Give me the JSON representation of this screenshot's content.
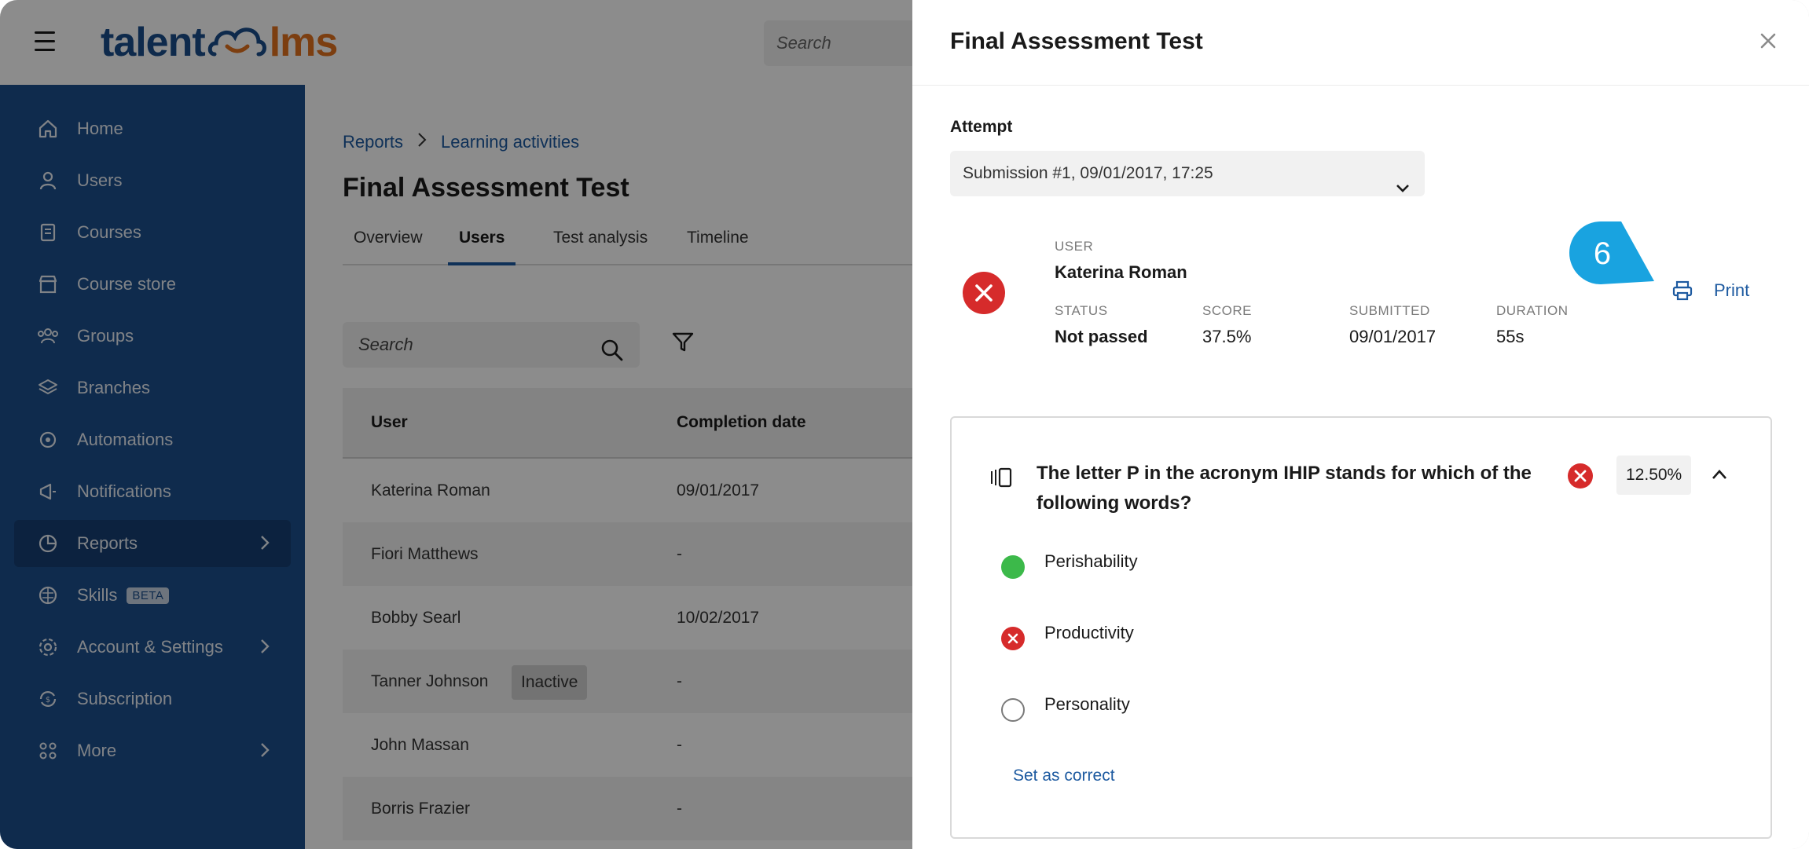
{
  "app": {
    "logo_part1": "talent",
    "logo_part2": "lms",
    "top_search_placeholder": "Search"
  },
  "sidebar": {
    "items": [
      {
        "label": "Home",
        "icon": "home-icon"
      },
      {
        "label": "Users",
        "icon": "user-icon"
      },
      {
        "label": "Courses",
        "icon": "book-icon"
      },
      {
        "label": "Course store",
        "icon": "store-icon"
      },
      {
        "label": "Groups",
        "icon": "groups-icon"
      },
      {
        "label": "Branches",
        "icon": "layers-icon"
      },
      {
        "label": "Automations",
        "icon": "automation-icon"
      },
      {
        "label": "Notifications",
        "icon": "megaphone-icon"
      },
      {
        "label": "Reports",
        "icon": "pie-chart-icon",
        "active": true,
        "has_submenu": true
      },
      {
        "label": "Skills",
        "icon": "brain-icon",
        "badge": "BETA"
      },
      {
        "label": "Account & Settings",
        "icon": "gear-icon",
        "has_submenu": true
      },
      {
        "label": "Subscription",
        "icon": "subscription-icon"
      },
      {
        "label": "More",
        "icon": "grid-icon",
        "has_submenu": true
      }
    ]
  },
  "main": {
    "breadcrumb": [
      "Reports",
      "Learning activities"
    ],
    "title": "Final Assessment Test",
    "tabs": [
      {
        "label": "Overview"
      },
      {
        "label": "Users",
        "active": true
      },
      {
        "label": "Test analysis"
      },
      {
        "label": "Timeline"
      }
    ],
    "search_placeholder": "Search",
    "table": {
      "columns": [
        "User",
        "Completion date"
      ],
      "rows": [
        {
          "user": "Katerina Roman",
          "date": "09/01/2017"
        },
        {
          "user": "Fiori Matthews",
          "date": "-"
        },
        {
          "user": "Bobby Searl",
          "date": "10/02/2017"
        },
        {
          "user": "Tanner Johnson",
          "badge": "Inactive",
          "date": "-"
        },
        {
          "user": "John Massan",
          "date": "-"
        },
        {
          "user": "Borris Frazier",
          "date": "-"
        }
      ]
    }
  },
  "drawer": {
    "title": "Final Assessment Test",
    "attempt_label": "Attempt",
    "attempt_value": "Submission #1, 09/01/2017, 17:25",
    "user_label": "USER",
    "user_name": "Katerina Roman",
    "status_label": "STATUS",
    "status_value": "Not passed",
    "score_label": "SCORE",
    "score_value": "37.5%",
    "submitted_label": "SUBMITTED",
    "submitted_value": "09/01/2017",
    "duration_label": "DURATION",
    "duration_value": "55s",
    "print_label": "Print",
    "callout_number": "6",
    "question": {
      "text": "The letter P in the acronym IHIP stands for which of the following words?",
      "score": "12.50%",
      "answers": [
        {
          "label": "Perishability",
          "state": "correct"
        },
        {
          "label": "Productivity",
          "state": "selected-wrong"
        },
        {
          "label": "Personality",
          "state": "unselected"
        }
      ],
      "set_correct_label": "Set as correct"
    }
  },
  "colors": {
    "sidebar": "#1d4f8c",
    "accent": "#1d5aa0",
    "error": "#d62b2b",
    "success": "#3cb94a",
    "callout": "#19a3e0"
  }
}
